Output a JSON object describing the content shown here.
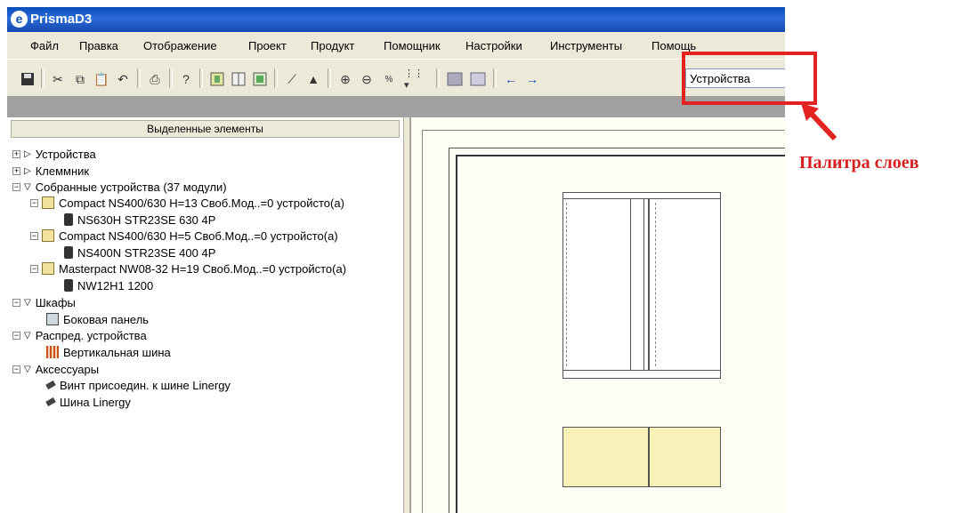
{
  "window": {
    "title": "PrismaD3"
  },
  "menu": [
    "Файл",
    "Правка",
    "Отображение",
    "Проект",
    "Продукт",
    "Помощник",
    "Настройки",
    "Инструменты",
    "Помощь"
  ],
  "toolbar": {
    "layer_value": "Устройства"
  },
  "panel": {
    "header": "Выделенные элементы"
  },
  "tree": [
    "Устройства",
    "Клеммник",
    "Собранные устройства (37 модули)",
    "Compact NS400/630  H=13 Своб.Мод..=0 устройсто(а)",
    "NS630H STR23SE 630 4P",
    "Compact NS400/630  H=5 Своб.Мод..=0 устройсто(а)",
    "NS400N STR23SE 400 4P",
    "Masterpact NW08-32  H=19 Своб.Мод..=0 устройсто(а)",
    "NW12H1 1200",
    "Шкафы",
    "Боковая панель",
    "Распред. устройства",
    "Вертикальная шина",
    "Аксессуары",
    "Винт присоедин. к шине Linergy",
    "Шина Linergy"
  ],
  "annotation": {
    "label": "Палитра слоев",
    "color": "#e32222"
  }
}
